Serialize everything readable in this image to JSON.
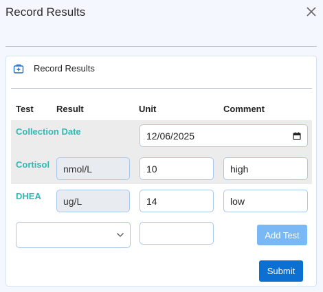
{
  "dialog": {
    "title": "Record Results"
  },
  "card": {
    "title": "Record Results",
    "icon": "medical-kit-icon"
  },
  "table": {
    "headers": {
      "test": "Test",
      "result": "Result",
      "unit": "Unit",
      "comment": "Comment"
    },
    "collection_date": {
      "label": "Collection Date",
      "value": "12/06/2025"
    },
    "rows": [
      {
        "test": "Cortisol",
        "unit": "nmol/L",
        "value": "10",
        "comment": "high"
      },
      {
        "test": "DHEA",
        "unit": "ug/L",
        "value": "14",
        "comment": "low"
      }
    ],
    "new_row": {
      "select_value": "",
      "input_value": ""
    }
  },
  "buttons": {
    "add_test": "Add Test",
    "submit": "Submit"
  },
  "colors": {
    "accent_teal": "#2fb9b3",
    "primary_blue": "#0c6fd2",
    "disabled_blue": "#7ab8f5"
  }
}
